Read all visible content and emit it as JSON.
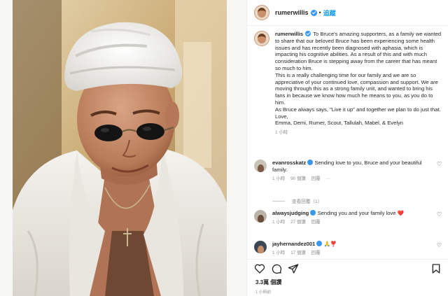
{
  "header": {
    "username": "rumerwillis",
    "separator": "•",
    "follow_label": "追蹤"
  },
  "caption": {
    "username": "rumerwillis",
    "paragraph_1": "To Bruce's amazing supporters, as a family we wanted to share that our beloved Bruce has been experiencing some health issues and has recently been diagnosed with aphasia, which is impacting his cognitive abilities. As a result of this and with much consideration Bruce is stepping away from the career that has meant so much to him.",
    "paragraph_2": "This is a really challenging time for our family and we are so appreciative of your continued love, compassion and support. We are moving through this as a strong family unit, and wanted to bring his fans in because we know how much he means to you, as you do to him.",
    "paragraph_3": "As Bruce always says, \"Live it up\" and together we plan to do just that.",
    "signoff": "Love,",
    "names": "Emma, Demi, Rumer, Scout, Tallulah, Mabel, & Evelyn",
    "time": "1 小時"
  },
  "comments": [
    {
      "username": "evanrosskatz",
      "text": "Sending love to you, Bruce and your beautiful family.",
      "time": "1 小時",
      "likes": "90 個讚",
      "reply": "回覆"
    },
    {
      "username": "alwaysjudging",
      "text": "Sending you and your family love",
      "emoji": "❤️",
      "time": "1 小時",
      "likes": "27 個讚",
      "reply": "回覆"
    },
    {
      "username": "jayhernandez001",
      "emoji": "🙏❣️",
      "time": "1 小時",
      "likes": "17 個讚",
      "reply": "回覆"
    }
  ],
  "view_replies": "查看回覆（1）",
  "icons": {
    "like": "heart-outline-icon",
    "comment": "comment-bubble-icon",
    "share": "paper-plane-icon",
    "save": "bookmark-icon",
    "verified": "verified-badge-icon",
    "more": "ellipsis-icon"
  },
  "footer": {
    "likes_count": "3.3萬 個讚",
    "post_time": "1 小時前"
  },
  "colors": {
    "accent": "#0095f6",
    "verified": "#3897f0",
    "muted": "#8e8e8e",
    "like_red": "#ed4956"
  }
}
